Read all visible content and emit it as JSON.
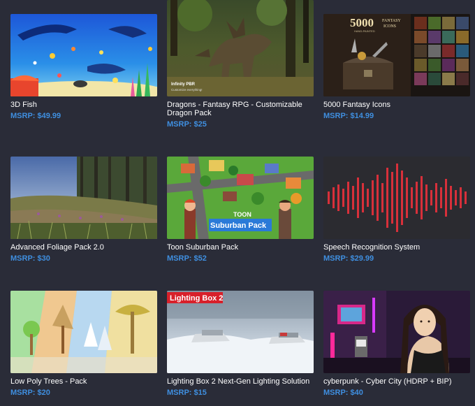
{
  "products": [
    {
      "title": "3D Fish",
      "price": "MSRP: $49.99",
      "image": "underwater-fish-scene"
    },
    {
      "title": "Dragons - Fantasy RPG - Customizable Dragon Pack",
      "price": "MSRP: $25",
      "image": "dragon-forest-scene",
      "overlay": [
        "Infinity PBR",
        "Customize everything!"
      ]
    },
    {
      "title": "5000 Fantasy Icons",
      "price": "MSRP: $14.99",
      "image": "fantasy-icons-chest",
      "overlay": [
        "5000",
        "FANTASY",
        "ICONS",
        "HAND-PAINTED"
      ]
    },
    {
      "title": "Advanced Foliage Pack 2.0",
      "price": "MSRP: $30",
      "image": "grass-field-forest"
    },
    {
      "title": "Toon Suburban Pack",
      "price": "MSRP: $52",
      "image": "toon-town-characters",
      "overlay": [
        "TOON",
        "Suburban Pack"
      ]
    },
    {
      "title": "Speech Recognition System",
      "price": "MSRP: $29.99",
      "image": "red-waveform"
    },
    {
      "title": "Low Poly Trees - Pack",
      "price": "MSRP: $20",
      "image": "low-poly-trees"
    },
    {
      "title": "Lighting Box 2 Next-Gen Lighting Solution",
      "price": "MSRP: $15",
      "image": "snowy-cars-scene",
      "overlay": [
        "Lighting Box 2"
      ]
    },
    {
      "title": "cyberpunk - Cyber City (HDRP + BIP)",
      "price": "MSRP: $40",
      "image": "cyberpunk-woman-neon"
    }
  ]
}
